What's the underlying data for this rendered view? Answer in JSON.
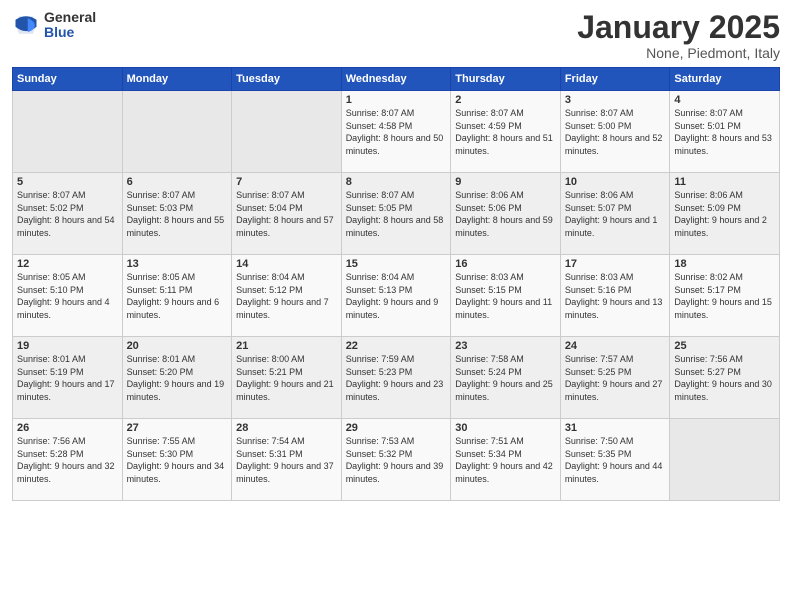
{
  "logo": {
    "general": "General",
    "blue": "Blue"
  },
  "header": {
    "month": "January 2025",
    "location": "None, Piedmont, Italy"
  },
  "days_of_week": [
    "Sunday",
    "Monday",
    "Tuesday",
    "Wednesday",
    "Thursday",
    "Friday",
    "Saturday"
  ],
  "weeks": [
    [
      {
        "day": "",
        "info": ""
      },
      {
        "day": "",
        "info": ""
      },
      {
        "day": "",
        "info": ""
      },
      {
        "day": "1",
        "info": "Sunrise: 8:07 AM\nSunset: 4:58 PM\nDaylight: 8 hours\nand 50 minutes."
      },
      {
        "day": "2",
        "info": "Sunrise: 8:07 AM\nSunset: 4:59 PM\nDaylight: 8 hours\nand 51 minutes."
      },
      {
        "day": "3",
        "info": "Sunrise: 8:07 AM\nSunset: 5:00 PM\nDaylight: 8 hours\nand 52 minutes."
      },
      {
        "day": "4",
        "info": "Sunrise: 8:07 AM\nSunset: 5:01 PM\nDaylight: 8 hours\nand 53 minutes."
      }
    ],
    [
      {
        "day": "5",
        "info": "Sunrise: 8:07 AM\nSunset: 5:02 PM\nDaylight: 8 hours\nand 54 minutes."
      },
      {
        "day": "6",
        "info": "Sunrise: 8:07 AM\nSunset: 5:03 PM\nDaylight: 8 hours\nand 55 minutes."
      },
      {
        "day": "7",
        "info": "Sunrise: 8:07 AM\nSunset: 5:04 PM\nDaylight: 8 hours\nand 57 minutes."
      },
      {
        "day": "8",
        "info": "Sunrise: 8:07 AM\nSunset: 5:05 PM\nDaylight: 8 hours\nand 58 minutes."
      },
      {
        "day": "9",
        "info": "Sunrise: 8:06 AM\nSunset: 5:06 PM\nDaylight: 8 hours\nand 59 minutes."
      },
      {
        "day": "10",
        "info": "Sunrise: 8:06 AM\nSunset: 5:07 PM\nDaylight: 9 hours\nand 1 minute."
      },
      {
        "day": "11",
        "info": "Sunrise: 8:06 AM\nSunset: 5:09 PM\nDaylight: 9 hours\nand 2 minutes."
      }
    ],
    [
      {
        "day": "12",
        "info": "Sunrise: 8:05 AM\nSunset: 5:10 PM\nDaylight: 9 hours\nand 4 minutes."
      },
      {
        "day": "13",
        "info": "Sunrise: 8:05 AM\nSunset: 5:11 PM\nDaylight: 9 hours\nand 6 minutes."
      },
      {
        "day": "14",
        "info": "Sunrise: 8:04 AM\nSunset: 5:12 PM\nDaylight: 9 hours\nand 7 minutes."
      },
      {
        "day": "15",
        "info": "Sunrise: 8:04 AM\nSunset: 5:13 PM\nDaylight: 9 hours\nand 9 minutes."
      },
      {
        "day": "16",
        "info": "Sunrise: 8:03 AM\nSunset: 5:15 PM\nDaylight: 9 hours\nand 11 minutes."
      },
      {
        "day": "17",
        "info": "Sunrise: 8:03 AM\nSunset: 5:16 PM\nDaylight: 9 hours\nand 13 minutes."
      },
      {
        "day": "18",
        "info": "Sunrise: 8:02 AM\nSunset: 5:17 PM\nDaylight: 9 hours\nand 15 minutes."
      }
    ],
    [
      {
        "day": "19",
        "info": "Sunrise: 8:01 AM\nSunset: 5:19 PM\nDaylight: 9 hours\nand 17 minutes."
      },
      {
        "day": "20",
        "info": "Sunrise: 8:01 AM\nSunset: 5:20 PM\nDaylight: 9 hours\nand 19 minutes."
      },
      {
        "day": "21",
        "info": "Sunrise: 8:00 AM\nSunset: 5:21 PM\nDaylight: 9 hours\nand 21 minutes."
      },
      {
        "day": "22",
        "info": "Sunrise: 7:59 AM\nSunset: 5:23 PM\nDaylight: 9 hours\nand 23 minutes."
      },
      {
        "day": "23",
        "info": "Sunrise: 7:58 AM\nSunset: 5:24 PM\nDaylight: 9 hours\nand 25 minutes."
      },
      {
        "day": "24",
        "info": "Sunrise: 7:57 AM\nSunset: 5:25 PM\nDaylight: 9 hours\nand 27 minutes."
      },
      {
        "day": "25",
        "info": "Sunrise: 7:56 AM\nSunset: 5:27 PM\nDaylight: 9 hours\nand 30 minutes."
      }
    ],
    [
      {
        "day": "26",
        "info": "Sunrise: 7:56 AM\nSunset: 5:28 PM\nDaylight: 9 hours\nand 32 minutes."
      },
      {
        "day": "27",
        "info": "Sunrise: 7:55 AM\nSunset: 5:30 PM\nDaylight: 9 hours\nand 34 minutes."
      },
      {
        "day": "28",
        "info": "Sunrise: 7:54 AM\nSunset: 5:31 PM\nDaylight: 9 hours\nand 37 minutes."
      },
      {
        "day": "29",
        "info": "Sunrise: 7:53 AM\nSunset: 5:32 PM\nDaylight: 9 hours\nand 39 minutes."
      },
      {
        "day": "30",
        "info": "Sunrise: 7:51 AM\nSunset: 5:34 PM\nDaylight: 9 hours\nand 42 minutes."
      },
      {
        "day": "31",
        "info": "Sunrise: 7:50 AM\nSunset: 5:35 PM\nDaylight: 9 hours\nand 44 minutes."
      },
      {
        "day": "",
        "info": ""
      }
    ]
  ]
}
